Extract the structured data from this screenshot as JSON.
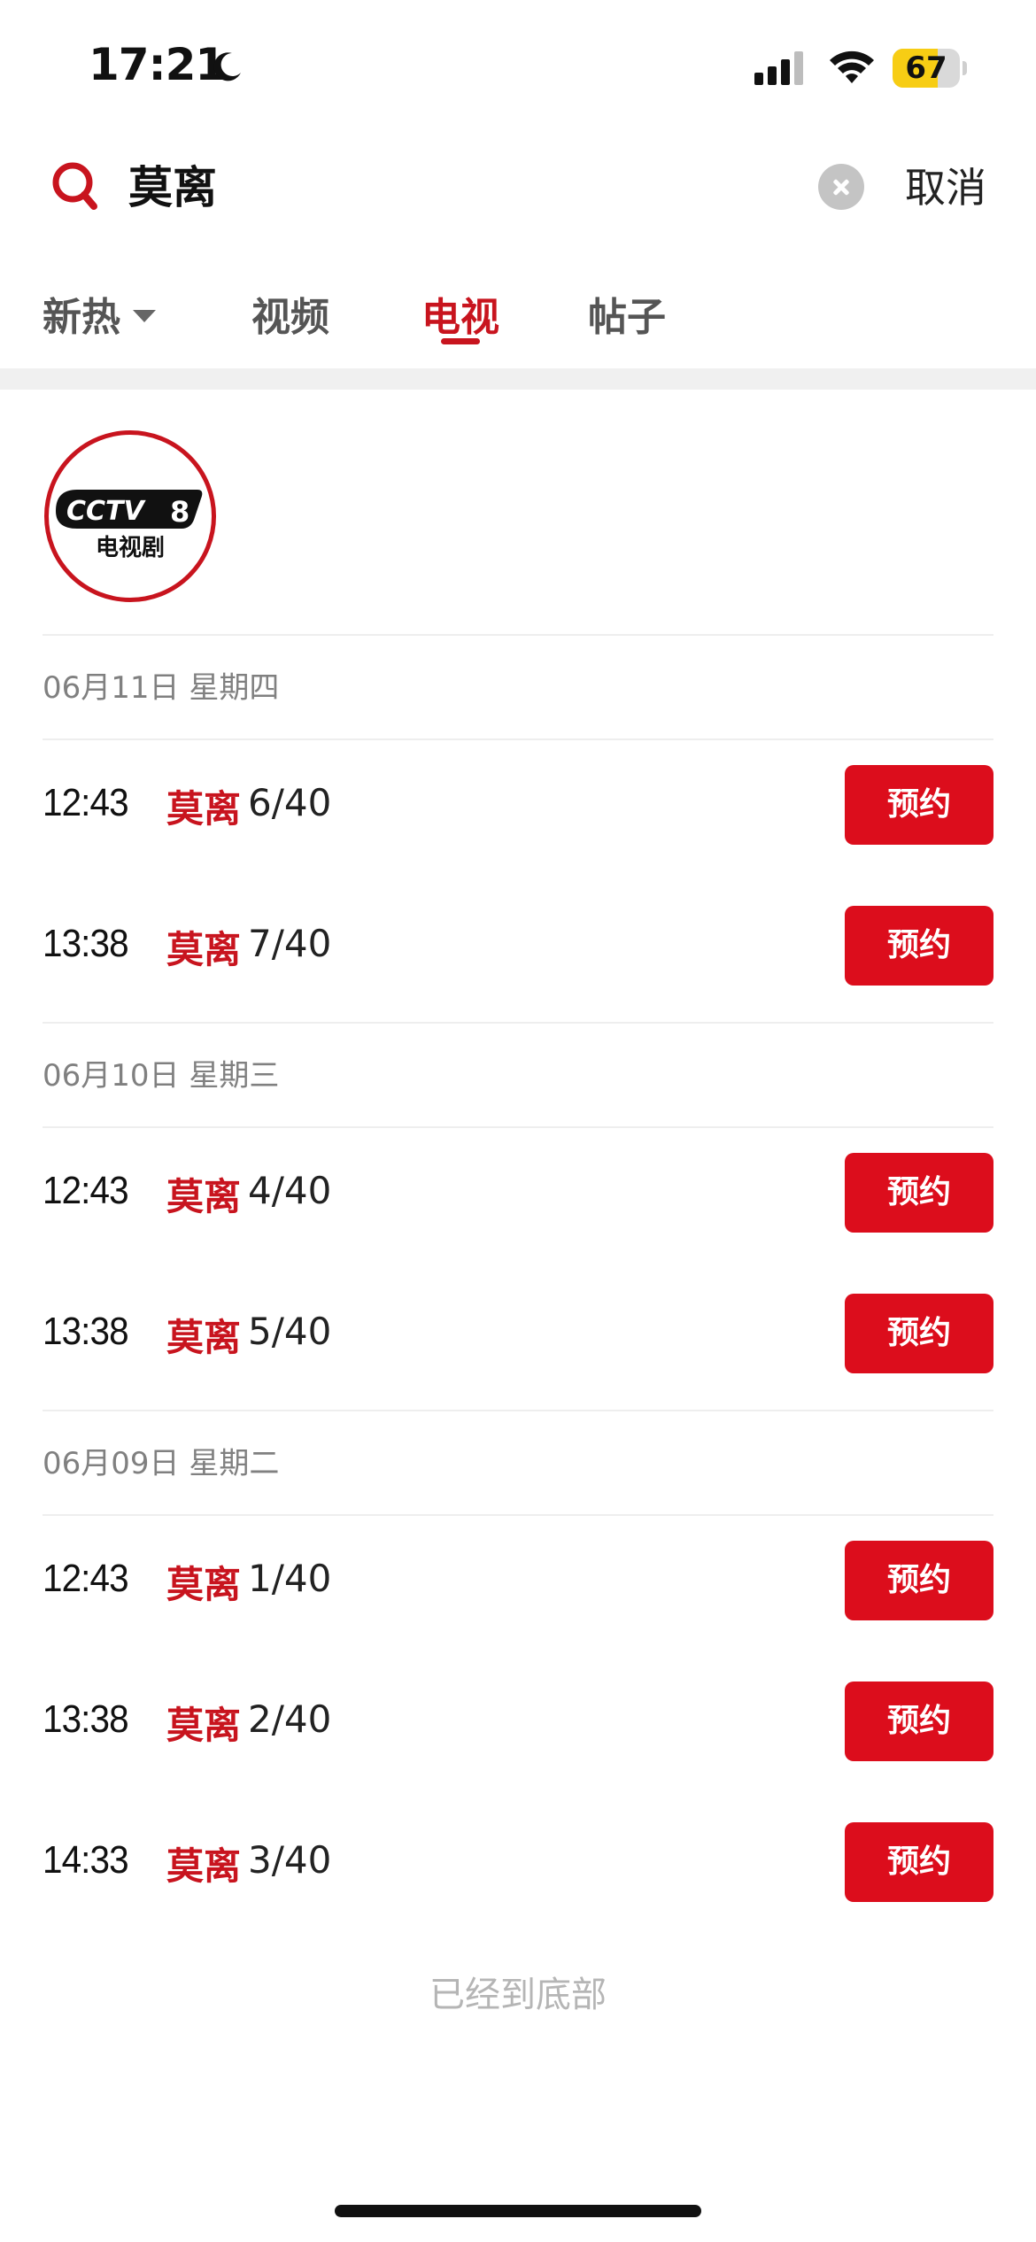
{
  "status_bar": {
    "time": "17:21",
    "battery": "67",
    "battery_level": 0.67
  },
  "search": {
    "query": "莫离",
    "cancel_label": "取消"
  },
  "tabs": [
    {
      "label": "新热",
      "active": false
    },
    {
      "label": "视频",
      "active": false
    },
    {
      "label": "电视",
      "active": true
    },
    {
      "label": "帖子",
      "active": false
    }
  ],
  "channel": {
    "logo_text": "CCTV",
    "number": "8",
    "subtitle": "电视剧"
  },
  "groups": [
    {
      "date": "06月11日  星期四",
      "items": [
        {
          "time": "12:43",
          "name": "莫离",
          "episode": "6/40",
          "button": "预约"
        },
        {
          "time": "13:38",
          "name": "莫离",
          "episode": "7/40",
          "button": "预约"
        }
      ]
    },
    {
      "date": "06月10日  星期三",
      "items": [
        {
          "time": "12:43",
          "name": "莫离",
          "episode": "4/40",
          "button": "预约"
        },
        {
          "time": "13:38",
          "name": "莫离",
          "episode": "5/40",
          "button": "预约"
        }
      ]
    },
    {
      "date": "06月09日  星期二",
      "items": [
        {
          "time": "12:43",
          "name": "莫离",
          "episode": "1/40",
          "button": "预约"
        },
        {
          "time": "13:38",
          "name": "莫离",
          "episode": "2/40",
          "button": "预约"
        },
        {
          "time": "14:33",
          "name": "莫离",
          "episode": "3/40",
          "button": "预约"
        }
      ]
    }
  ],
  "footer": {
    "end_text": "已经到底部"
  },
  "colors": {
    "accent": "#c8141e",
    "button": "#dc0d1c",
    "battery": "#f7cd14"
  }
}
